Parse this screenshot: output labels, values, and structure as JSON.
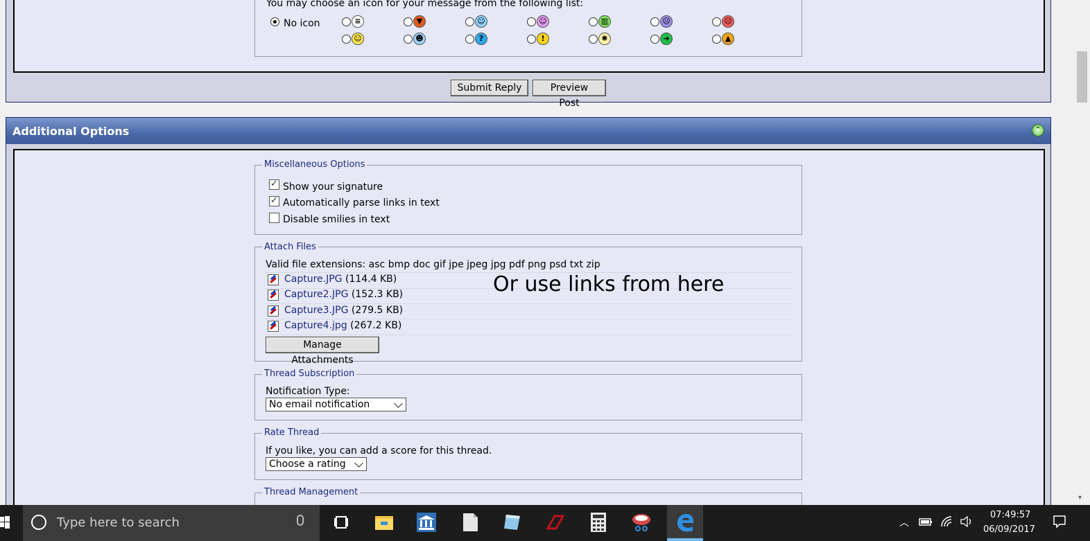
{
  "post_icons": {
    "legend": "You may choose an icon for your message from the following list:",
    "no_icon_label": "No icon",
    "icons": [
      {
        "name": "note-icon",
        "glyph": "≡",
        "color": "#ffffff"
      },
      {
        "name": "thumbs-down-icon",
        "glyph": "▼",
        "color": "#e05a1c"
      },
      {
        "name": "wink-icon",
        "glyph": "☺",
        "color": "#8fd3ff"
      },
      {
        "name": "tongue-icon",
        "glyph": "☺",
        "color": "#e49bf0"
      },
      {
        "name": "grin-icon",
        "glyph": "▥",
        "color": "#7ddc5d"
      },
      {
        "name": "sad-icon",
        "glyph": "☹",
        "color": "#9b8de6"
      },
      {
        "name": "angry-icon",
        "glyph": "☹",
        "color": "#f25a5a"
      },
      {
        "name": "smile-icon",
        "glyph": "☺",
        "color": "#ffe84d"
      },
      {
        "name": "cool-icon",
        "glyph": "☻",
        "color": "#9ad6ff"
      },
      {
        "name": "question-icon",
        "glyph": "?",
        "color": "#2fa6ea"
      },
      {
        "name": "exclamation-icon",
        "glyph": "!",
        "color": "#ffd21a"
      },
      {
        "name": "lightbulb-icon",
        "glyph": "✺",
        "color": "#fff6a8"
      },
      {
        "name": "arrow-icon",
        "glyph": "➜",
        "color": "#1fbf4a"
      },
      {
        "name": "thumbs-up-icon",
        "glyph": "▲",
        "color": "#f0a41c"
      }
    ]
  },
  "buttons": {
    "submit_reply": "Submit Reply",
    "preview_post": "Preview Post",
    "manage_attachments": "Manage Attachments"
  },
  "additional_options": {
    "title": "Additional Options",
    "misc": {
      "legend": "Miscellaneous Options",
      "show_signature": "Show your signature",
      "parse_links": "Automatically parse links in text",
      "disable_smilies": "Disable smilies in text"
    },
    "attach": {
      "legend": "Attach Files",
      "valid_ext": "Valid file extensions: asc bmp doc gif jpe jpeg jpg pdf png psd txt zip",
      "files": [
        {
          "name": "Capture.JPG",
          "size": "(114.4 KB)"
        },
        {
          "name": "Capture2.JPG",
          "size": "(152.3 KB)"
        },
        {
          "name": "Capture3.JPG",
          "size": "(279.5 KB)"
        },
        {
          "name": "Capture4.jpg",
          "size": "(267.2 KB)"
        }
      ],
      "annotation": "Or use links from here"
    },
    "subscription": {
      "legend": "Thread Subscription",
      "label": "Notification Type:",
      "selected": "No email notification"
    },
    "rate": {
      "legend": "Rate Thread",
      "label": "If you like, you can add a score for this thread.",
      "selected": "Choose a rating"
    },
    "management": {
      "legend": "Thread Management"
    }
  },
  "taskbar": {
    "search_placeholder": "Type here to search",
    "time": "07:49:57",
    "date": "06/09/2017"
  }
}
